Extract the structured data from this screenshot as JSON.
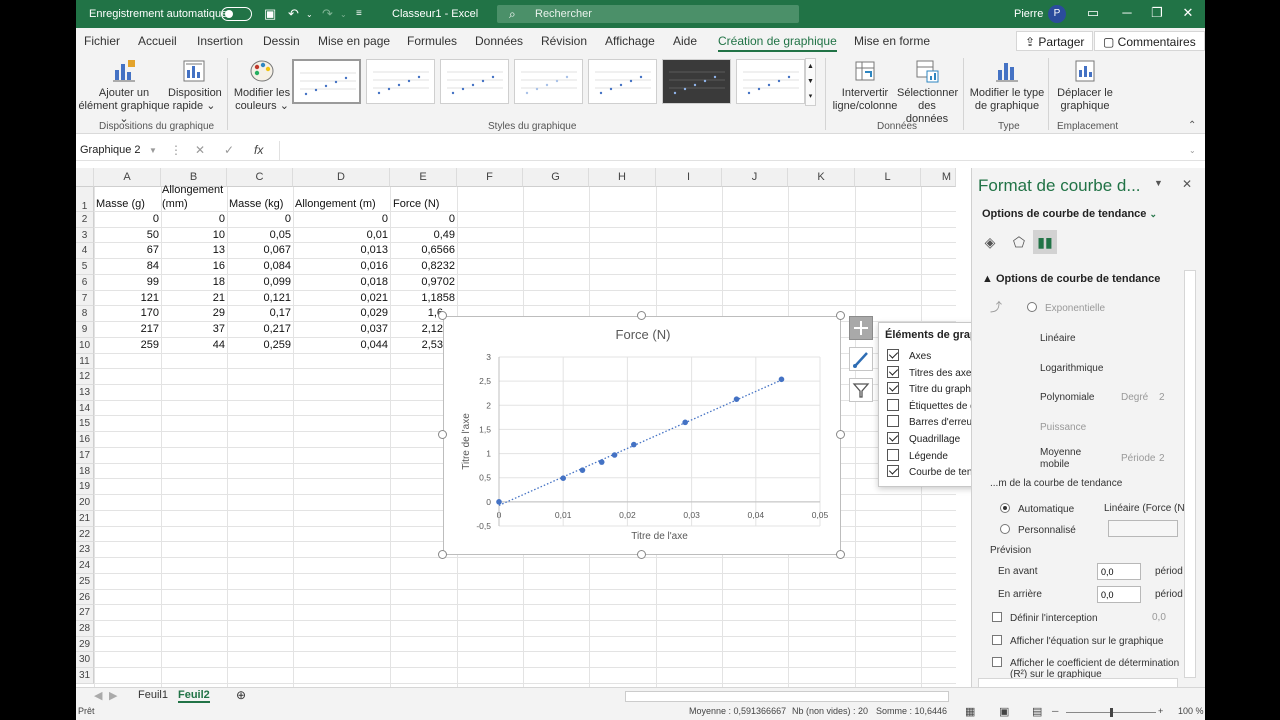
{
  "titlebar": {
    "autosave": "Enregistrement automatique",
    "title": "Classeur1  -  Excel",
    "search_placeholder": "Rechercher",
    "user": "Pierre",
    "avatar": "P"
  },
  "tabs": [
    "Fichier",
    "Accueil",
    "Insertion",
    "Dessin",
    "Mise en page",
    "Formules",
    "Données",
    "Révision",
    "Affichage",
    "Aide",
    "Création de graphique",
    "Mise en forme"
  ],
  "active_tab": "Création de graphique",
  "share": "Partager",
  "comments": "Commentaires",
  "ribbon": {
    "add_element": "Ajouter un élément graphique",
    "quick_layout": "Disposition rapide",
    "change_colors": "Modifier les couleurs",
    "switch_row_col": "Intervertir ligne/colonne",
    "select_data": "Sélectionner des données",
    "change_type": "Modifier le type de graphique",
    "move_chart": "Déplacer le graphique",
    "groups": {
      "layouts": "Dispositions du graphique",
      "styles": "Styles du graphique",
      "data": "Données",
      "type": "Type",
      "location": "Emplacement"
    }
  },
  "formula": {
    "namebox": "Graphique 2",
    "fx": "fx"
  },
  "columns": [
    "A",
    "B",
    "C",
    "D",
    "E",
    "F",
    "G",
    "H",
    "I",
    "J",
    "K",
    "L",
    "M"
  ],
  "rows": [
    "1",
    "2",
    "3",
    "4",
    "5",
    "6",
    "7",
    "8",
    "9",
    "10",
    "11",
    "12",
    "13",
    "14",
    "15",
    "16",
    "17",
    "18",
    "19",
    "20",
    "21",
    "22",
    "23",
    "24",
    "25",
    "26",
    "27",
    "28",
    "29",
    "30",
    "31"
  ],
  "headers": {
    "a": "Masse (g)",
    "b1": "Allongement",
    "b2": "(mm)",
    "c": "Masse (kg)",
    "d": "Allongement (m)",
    "e": "Force (N)"
  },
  "table": [
    [
      "0",
      "0",
      "0",
      "0",
      "0"
    ],
    [
      "50",
      "10",
      "0,05",
      "0,01",
      "0,49"
    ],
    [
      "67",
      "13",
      "0,067",
      "0,013",
      "0,6566"
    ],
    [
      "84",
      "16",
      "0,084",
      "0,016",
      "0,8232"
    ],
    [
      "99",
      "18",
      "0,099",
      "0,018",
      "0,9702"
    ],
    [
      "121",
      "21",
      "0,121",
      "0,021",
      "1,1858"
    ],
    [
      "170",
      "29",
      "0,17",
      "0,029",
      "1,6"
    ],
    [
      "217",
      "37",
      "0,217",
      "0,037",
      "2,12"
    ],
    [
      "259",
      "44",
      "0,259",
      "0,044",
      "2,53"
    ]
  ],
  "chart_data": {
    "type": "scatter",
    "title": "Force (N)",
    "xlabel": "Titre de l'axe",
    "ylabel": "Titre de l'axe",
    "x": [
      0,
      0.01,
      0.013,
      0.016,
      0.018,
      0.021,
      0.029,
      0.037,
      0.044
    ],
    "series": [
      {
        "values": [
          0,
          0.49,
          0.6566,
          0.8232,
          0.9702,
          1.1858,
          1.6464,
          2.1266,
          2.5382
        ]
      }
    ],
    "xlim": [
      0,
      0.05
    ],
    "ylim": [
      -0.5,
      3
    ],
    "xticks": [
      "0",
      "0,01",
      "0,02",
      "0,03",
      "0,04",
      "0,05"
    ],
    "yticks": [
      "-0,5",
      "0",
      "0,5",
      "1",
      "1,5",
      "2",
      "2,5",
      "3"
    ],
    "grid": true,
    "trendline": "linear",
    "marker_color": "#4472c4"
  },
  "elements_popup": {
    "title": "Éléments de graphique",
    "items": [
      {
        "label": "Axes",
        "checked": true
      },
      {
        "label": "Titres des axes",
        "checked": true
      },
      {
        "label": "Titre du graphique",
        "checked": true
      },
      {
        "label": "Étiquettes de données",
        "checked": false
      },
      {
        "label": "Barres d'erreur",
        "checked": false
      },
      {
        "label": "Quadrillage",
        "checked": true
      },
      {
        "label": "Légende",
        "checked": false
      },
      {
        "label": "Courbe de tendance",
        "checked": true
      }
    ]
  },
  "pane": {
    "title": "Format de courbe d...",
    "subtitle": "Options de courbe de tendance",
    "section": "Options de courbe de tendance",
    "types": {
      "exponential": "Exponentielle",
      "linear": "Linéaire",
      "log": "Logarithmique",
      "poly": "Polynomiale",
      "degree": "Degré",
      "degree_value": "2",
      "power": "Puissance",
      "moving_avg_1": "Moyenne",
      "moving_avg_2": "mobile",
      "period": "Période",
      "period_value": "2"
    },
    "name_label": "...m de la courbe de tendance",
    "auto": "Automatique",
    "auto_value": "Linéaire (Force (N",
    "custom": "Personnalisé",
    "forecast": "Prévision",
    "forward": "En avant",
    "forward_value": "0,0",
    "backward": "En arrière",
    "backward_value": "0,0",
    "periods_label": "périod",
    "intercept": "Définir l'interception",
    "intercept_value": "0,0",
    "show_equation": "Afficher l'équation sur le graphique",
    "show_r2_1": "Afficher le coefficient de détermination",
    "show_r2_2": "(R²) sur le graphique"
  },
  "sheets": [
    "Feuil1",
    "Feuil2"
  ],
  "active_sheet": "Feuil2",
  "status": {
    "ready": "Prêt",
    "average": "Moyenne : 0,591366667",
    "count": "Nb (non vides) : 20",
    "sum": "Somme : 10,6446",
    "zoom": "100 %"
  }
}
